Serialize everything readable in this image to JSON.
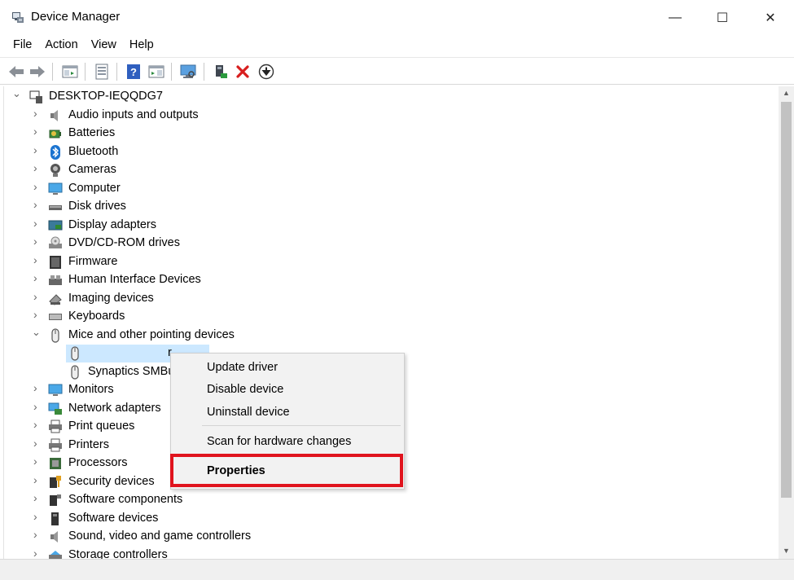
{
  "window": {
    "title": "Device Manager",
    "minimize_glyph": "—",
    "maximize_glyph": "☐",
    "close_glyph": "✕"
  },
  "menu": [
    "File",
    "Action",
    "View",
    "Help"
  ],
  "toolbar": {
    "buttons": [
      "back-icon",
      "forward-icon",
      "show-hide-console-tree-icon",
      "properties-icon",
      "help-icon",
      "action-pane-icon",
      "scan-hardware-icon",
      "update-driver-icon",
      "uninstall-icon",
      "disable-device-icon"
    ]
  },
  "tree": {
    "root": "DESKTOP-IEQQDG7",
    "categories": [
      {
        "label": "Audio inputs and outputs",
        "icon": "speaker-icon",
        "expanded": false
      },
      {
        "label": "Batteries",
        "icon": "battery-icon",
        "expanded": false
      },
      {
        "label": "Bluetooth",
        "icon": "bluetooth-icon",
        "expanded": false
      },
      {
        "label": "Cameras",
        "icon": "camera-icon",
        "expanded": false
      },
      {
        "label": "Computer",
        "icon": "computer-icon",
        "expanded": false
      },
      {
        "label": "Disk drives",
        "icon": "disk-drive-icon",
        "expanded": false
      },
      {
        "label": "Display adapters",
        "icon": "display-adapter-icon",
        "expanded": false
      },
      {
        "label": "DVD/CD-ROM drives",
        "icon": "dvd-drive-icon",
        "expanded": false
      },
      {
        "label": "Firmware",
        "icon": "firmware-icon",
        "expanded": false
      },
      {
        "label": "Human Interface Devices",
        "icon": "hid-icon",
        "expanded": false
      },
      {
        "label": "Imaging devices",
        "icon": "scanner-icon",
        "expanded": false
      },
      {
        "label": "Keyboards",
        "icon": "keyboard-icon",
        "expanded": false
      },
      {
        "label": "Mice and other pointing devices",
        "icon": "mouse-icon",
        "expanded": true,
        "children": [
          {
            "label": "r",
            "icon": "mouse-icon",
            "selected": true
          },
          {
            "label": "Synaptics SMBu",
            "icon": "mouse-icon",
            "selected": false
          }
        ]
      },
      {
        "label": "Monitors",
        "icon": "monitor-icon",
        "expanded": false
      },
      {
        "label": "Network adapters",
        "icon": "network-adapter-icon",
        "expanded": false
      },
      {
        "label": "Print queues",
        "icon": "printer-icon",
        "expanded": false
      },
      {
        "label": "Printers",
        "icon": "printer-icon",
        "expanded": false
      },
      {
        "label": "Processors",
        "icon": "processor-icon",
        "expanded": false
      },
      {
        "label": "Security devices",
        "icon": "security-key-icon",
        "expanded": false
      },
      {
        "label": "Software components",
        "icon": "software-component-icon",
        "expanded": false
      },
      {
        "label": "Software devices",
        "icon": "software-device-icon",
        "expanded": false
      },
      {
        "label": "Sound, video and game controllers",
        "icon": "speaker-icon",
        "expanded": false
      },
      {
        "label": "Storage controllers",
        "icon": "storage-controller-icon",
        "expanded": false
      }
    ]
  },
  "context_menu": {
    "items": [
      {
        "label": "Update driver"
      },
      {
        "label": "Disable device"
      },
      {
        "label": "Uninstall device"
      },
      {
        "label": "Scan for hardware changes"
      },
      {
        "label": "Properties",
        "bold": true
      }
    ],
    "highlight_color": "#e0141e"
  },
  "colors": {
    "selection": "#cce8ff",
    "menu_bg": "#f2f2f2"
  }
}
